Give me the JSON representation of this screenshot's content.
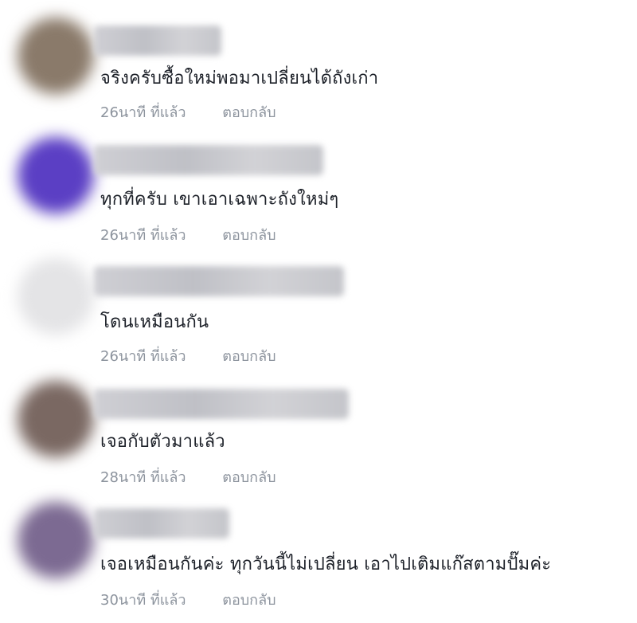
{
  "comments": [
    {
      "text": "จริงครับซื้อใหม่พอมาเปลี่ยนได้ถังเก่า",
      "time": "26นาที ที่แล้ว",
      "reply": "ตอบกลับ",
      "avatar_color": "#8a7a6a"
    },
    {
      "text": "ทุกที่ครับ เขาเอาเฉพาะถังใหม่ๆ",
      "time": "26นาที ที่แล้ว",
      "reply": "ตอบกลับ",
      "avatar_color": "#5b3fc4"
    },
    {
      "text": "โดนเหมือนกัน",
      "time": "26นาที ที่แล้ว",
      "reply": "ตอบกลับ",
      "avatar_color": "#e4e4e6"
    },
    {
      "text": "เจอกับตัวมาแล้ว",
      "time": "28นาที ที่แล้ว",
      "reply": "ตอบกลับ",
      "avatar_color": "#7a6862"
    },
    {
      "text": "เจอเหมือนกันค่ะ ทุกวันนี้ไม่เปลี่ยน เอาไปเติมแก๊สตามปั๊มค่ะ",
      "time": "30นาที ที่แล้ว",
      "reply": "ตอบกลับ",
      "avatar_color": "#7c6a92"
    }
  ]
}
